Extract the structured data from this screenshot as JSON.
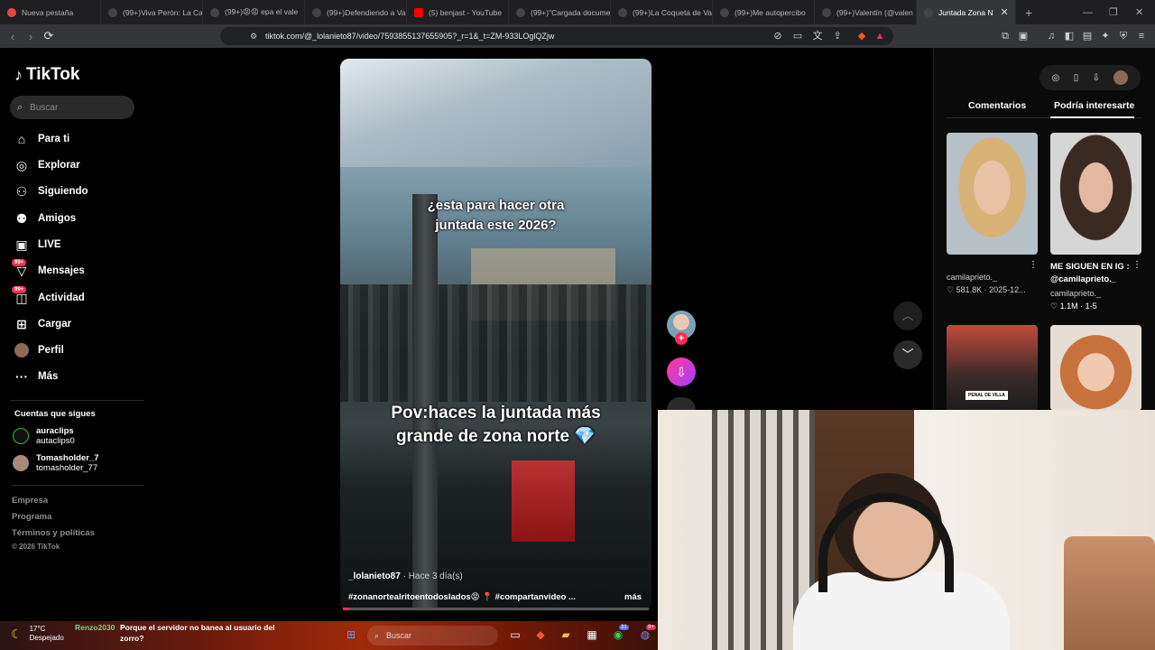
{
  "browser": {
    "tabs": [
      {
        "title": "Nueva pestaña",
        "color": "#e04a3a"
      },
      {
        "title": "(99+)Viva Perón: La Ca",
        "color": "#111"
      },
      {
        "title": "(99+)😡😡 epa el vale",
        "color": "#111"
      },
      {
        "title": "(99+)Defendiendo a Va",
        "color": "#111"
      },
      {
        "title": "(5) benjast - YouTube",
        "color": "#ff0000"
      },
      {
        "title": "(99+)\"Cargada docume",
        "color": "#111"
      },
      {
        "title": "(99+)La Coqueta de Va",
        "color": "#111"
      },
      {
        "title": "(99+)Me autopercibo",
        "color": "#111"
      },
      {
        "title": "(99+)Valentín (@valen",
        "color": "#111"
      },
      {
        "title": "Juntada Zona N",
        "color": "#111"
      }
    ],
    "new_tab": "+",
    "url": "tiktok.com/@_lolanieto87/video/7593855137655905?_r=1&_t=ZM-933LOglQZjw"
  },
  "sidebar": {
    "logo": "TikTok",
    "search_placeholder": "Buscar",
    "items": [
      {
        "label": "Para ti",
        "icon": "home-icon"
      },
      {
        "label": "Explorar",
        "icon": "compass-icon"
      },
      {
        "label": "Siguiendo",
        "icon": "following-icon"
      },
      {
        "label": "Amigos",
        "icon": "friends-icon"
      },
      {
        "label": "LIVE",
        "icon": "live-icon"
      },
      {
        "label": "Mensajes",
        "icon": "messages-icon",
        "badge": "99+"
      },
      {
        "label": "Actividad",
        "icon": "activity-icon",
        "badge": "99+"
      },
      {
        "label": "Cargar",
        "icon": "upload-icon"
      },
      {
        "label": "Perfil",
        "icon": "profile-icon"
      },
      {
        "label": "Más",
        "icon": "more-icon"
      }
    ],
    "following_title": "Cuentas que sigues",
    "following": [
      {
        "name": "auraclips",
        "handle": "autaclips0"
      },
      {
        "name": "Tomasholder_7",
        "handle": "tomasholder_77"
      }
    ],
    "footer": [
      "Empresa",
      "Programa",
      "Términos y políticas",
      "© 2026 TikTok"
    ]
  },
  "video": {
    "overlay_top": [
      "¿esta para hacer otra",
      "juntada este 2026?"
    ],
    "overlay_mid": [
      "Pov:haces la juntada más",
      "grande de zona norte 💎"
    ],
    "author": "_lolanieto87",
    "time": "· Hace 3 día(s)",
    "caption": "#zonanortealritoentodoslados😡 📍 #compartanvideo ...",
    "more": "más",
    "progress": 0.02
  },
  "right_panel": {
    "tabs": [
      "Comentarios",
      "Podría interesarte"
    ],
    "active_tab": "Podría interesarte",
    "cards": [
      {
        "author": "camilaprieto._",
        "likes": "581.8K",
        "date": "2025-12..."
      },
      {
        "title": "ME SIGUEN EN IG : @camilaprieto._",
        "author": "camilaprieto._",
        "likes": "1.1M",
        "date": "1-5"
      }
    ],
    "thumb_label": "PENAL DE VILLA"
  },
  "taskbar": {
    "temp": "17°C",
    "weather": "Despejado",
    "chat_user": "Renzo2030",
    "chat_message": "Porque el servidor no banea al usuario del zorro?",
    "search": "Buscar",
    "badges": [
      "31",
      "9+"
    ]
  }
}
